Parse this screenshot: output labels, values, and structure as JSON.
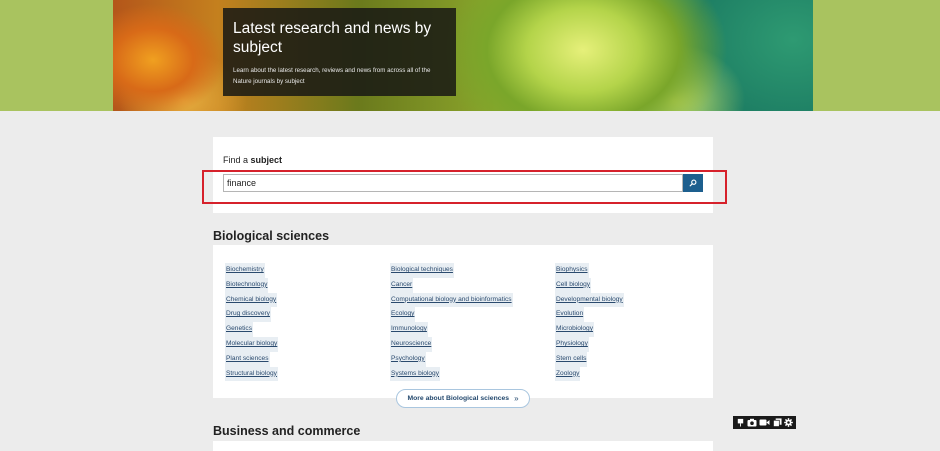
{
  "hero": {
    "title": "Latest research and news by subject",
    "subtitle": "Learn about the latest research, reviews and news from across all of the Nature journals by subject"
  },
  "search": {
    "label_prefix": "Find a ",
    "label_bold": "subject",
    "value": "finance",
    "button_icon": "search-icon"
  },
  "biological": {
    "title": "Biological sciences",
    "columns": [
      [
        "Biochemistry",
        "Biotechnology",
        "Chemical biology",
        "Drug discovery",
        "Genetics",
        "Molecular biology",
        "Plant sciences",
        "Structural biology"
      ],
      [
        "Biological techniques",
        "Cancer",
        "Computational biology and bioinformatics",
        "Ecology",
        "Immunology",
        "Neuroscience",
        "Psychology",
        "Systems biology"
      ],
      [
        "Biophysics",
        "Cell biology",
        "Developmental biology",
        "Evolution",
        "Microbiology",
        "Physiology",
        "Stem cells",
        "Zoology"
      ]
    ],
    "more_label": "More about Biological sciences",
    "more_icon": "double-chevron-right-icon"
  },
  "business": {
    "title": "Business and commerce"
  },
  "toolbar": {
    "icons": [
      "pin-icon",
      "camera-icon",
      "video-icon",
      "copy-icon",
      "gear-icon"
    ]
  },
  "colors": {
    "hero_bg": "#a9c35f",
    "accent_blue": "#1d5f8e",
    "highlight_red": "#d6212b",
    "page_bg": "#ececec"
  }
}
